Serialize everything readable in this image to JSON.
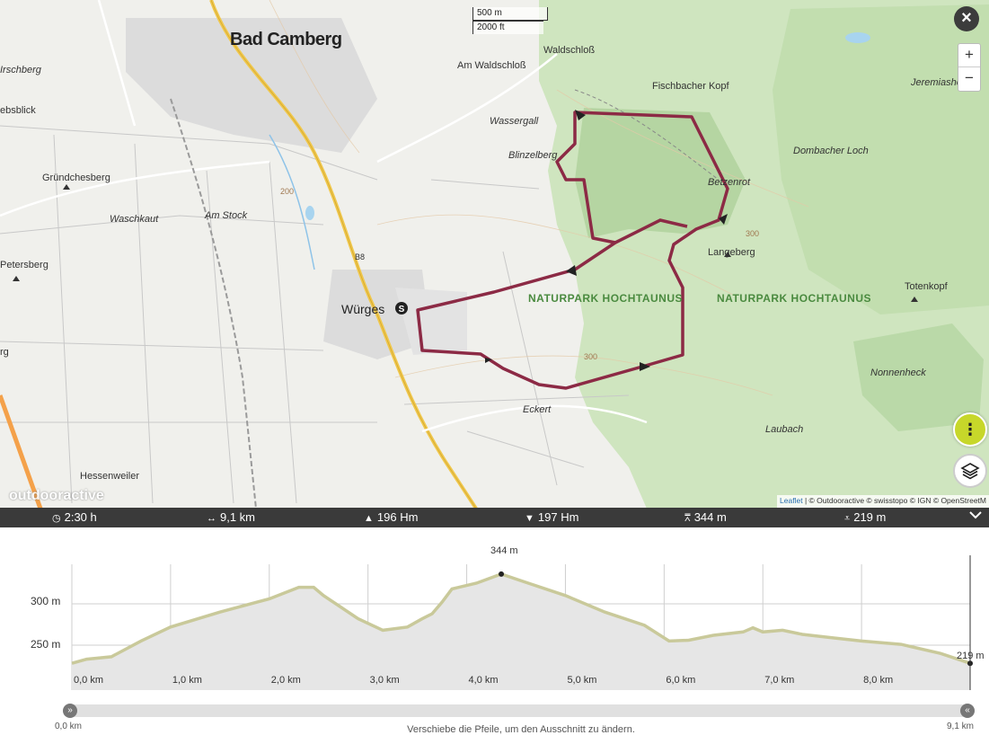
{
  "map": {
    "town_major": "Bad Camberg",
    "town_minor": "Würges",
    "labels": [
      "Waldschloß",
      "Am Waldschloß",
      "Fischbacher Kopf",
      "Jeremiasheck",
      "Wassergall",
      "Blinzelberg",
      "Dombacher Loch",
      "Betzenrot",
      "Gründchesberg",
      "Waschkaut",
      "Am Stock",
      "Petersberg",
      "Langeberg",
      "Totenkopf",
      "Nonnenheck",
      "Eckert",
      "Laubach",
      "Hessenweiler",
      "ebsblick",
      "Irschberg",
      "rg"
    ],
    "naturpark": [
      "NATURPARK HOCHTAUNUS",
      "NATURPARK HOCHTAUNUS"
    ],
    "road_label": "B8",
    "contour_labels": [
      "300",
      "300",
      "200"
    ],
    "scale_metric": "500 m",
    "scale_imperial": "2000 ft",
    "zoom_in": "+",
    "zoom_out": "−",
    "close": "×",
    "brand": "outdooractive",
    "attribution_leaflet": "Leaflet",
    "attribution_rest": " | © Outdooractive © swisstopo © IGN © OpenStreetM",
    "start_marker": "S",
    "menu_icon": "kebab-icon",
    "layers_icon": "layers-icon"
  },
  "stats": {
    "duration": "2:30 h",
    "distance": "9,1 km",
    "ascent": "196 Hm",
    "descent": "197 Hm",
    "highest": "344 m",
    "lowest": "219 m"
  },
  "profile": {
    "peak_label": "344 m",
    "end_label": "219 m",
    "y_labels": [
      "300 m",
      "250 m"
    ],
    "x_labels": [
      "0,0 km",
      "1,0 km",
      "2,0 km",
      "3,0 km",
      "4,0 km",
      "5,0 km",
      "6,0 km",
      "7,0 km",
      "8,0 km"
    ],
    "slider_start": "0,0 km",
    "slider_end": "9,1 km",
    "hint": "Verschiebe die Pfeile, um den Ausschnitt zu ändern.",
    "line_color": "#c9c99a"
  },
  "chart_data": {
    "type": "area",
    "xlabel": "",
    "ylabel": "",
    "x_unit": "km",
    "y_unit": "m",
    "ylim": [
      225,
      355
    ],
    "xlim": [
      0,
      9.1
    ],
    "x": [
      0,
      0.15,
      0.4,
      0.7,
      1.0,
      1.5,
      2.0,
      2.3,
      2.45,
      2.55,
      2.9,
      3.15,
      3.4,
      3.55,
      3.65,
      3.75,
      3.85,
      4.1,
      4.35,
      4.6,
      5.0,
      5.4,
      5.8,
      6.05,
      6.25,
      6.5,
      6.8,
      6.9,
      7.0,
      7.2,
      7.4,
      7.7,
      8.0,
      8.4,
      8.8,
      9.1
    ],
    "values": [
      228,
      233,
      236,
      255,
      272,
      290,
      306,
      320,
      320,
      310,
      282,
      268,
      272,
      282,
      288,
      302,
      318,
      325,
      336,
      326,
      310,
      290,
      274,
      255,
      256,
      262,
      266,
      271,
      266,
      268,
      263,
      259,
      255,
      251,
      240,
      228
    ],
    "annotations": [
      {
        "x": 4.35,
        "y": 344,
        "label": "344 m"
      },
      {
        "x": 9.1,
        "y": 219,
        "label": "219 m"
      }
    ]
  }
}
